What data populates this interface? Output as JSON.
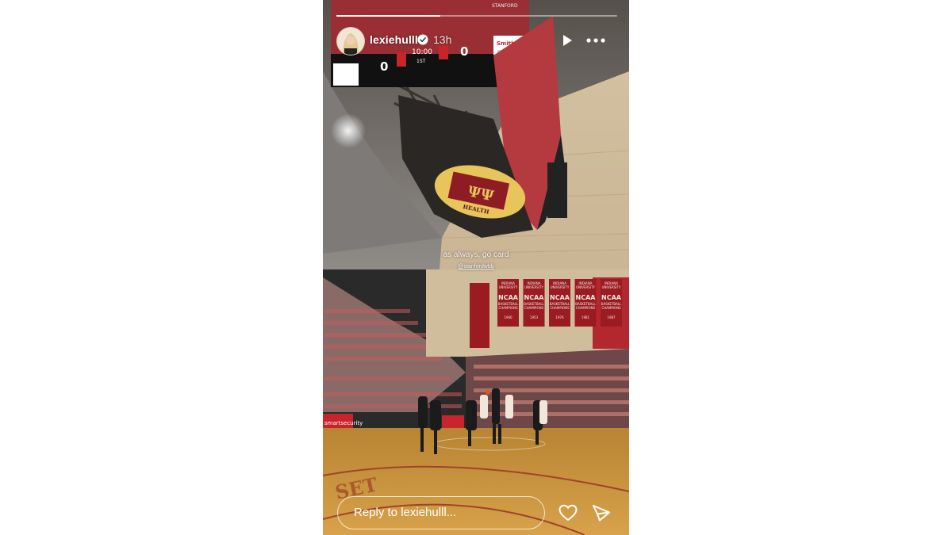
{
  "story": {
    "username": "lexiehulll",
    "verified": true,
    "time_ago": "13h",
    "progress_fraction": 0.37,
    "caption": "as always, go card",
    "mention": "@stanfordwbb",
    "reply_placeholder": "Reply to lexiehulll..."
  },
  "scene": {
    "scoreboard": {
      "team_label": "STANFORD",
      "home_score": "0",
      "away_score": "0",
      "clock": "10:00",
      "period": "1ST",
      "sponsor": "Smithville",
      "sponsor_url": "smithville.com"
    },
    "logo_text": "HEALTH",
    "banners": [
      {
        "line1": "INDIANA",
        "line2": "UNIVERSITY",
        "title": "NCAA",
        "line3": "BASKETBALL",
        "line4": "CHAMPIONS",
        "year": "1940"
      },
      {
        "line1": "INDIANA",
        "line2": "UNIVERSITY",
        "title": "NCAA",
        "line3": "BASKETBALL",
        "line4": "CHAMPIONS",
        "year": "1953"
      },
      {
        "line1": "INDIANA",
        "line2": "UNIVERSITY",
        "title": "NCAA",
        "line3": "BASKETBALL",
        "line4": "CHAMPIONS",
        "year": "1976"
      },
      {
        "line1": "INDIANA",
        "line2": "UNIVERSITY",
        "title": "NCAA",
        "line3": "BASKETBALL",
        "line4": "CHAMPIONS",
        "year": "1981"
      },
      {
        "line1": "INDIANA",
        "line2": "UNIVERSITY",
        "title": "NCAA",
        "line3": "BASKETBALL",
        "line4": "CHAMPIONS",
        "year": "1987"
      }
    ],
    "courtside_ad": "smartsecurity",
    "floor_text": "SET"
  },
  "colors": {
    "crimson": "#9b1b22",
    "court_wood": "#c9953e",
    "logo_gold": "#e8c55a",
    "wall": "#d8c7a8"
  },
  "icons": {
    "play": "play-icon",
    "more": "more-options-icon",
    "verified": "verified-badge-icon",
    "heart": "heart-icon",
    "send": "send-icon"
  }
}
